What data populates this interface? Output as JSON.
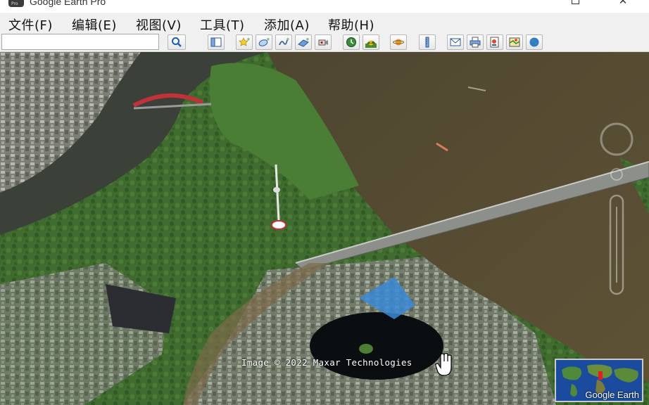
{
  "window": {
    "title": "Google Earth Pro",
    "app_icon_text": "Pro",
    "minimize_glyph": "—",
    "close_glyph": "✕"
  },
  "menu": {
    "items": [
      {
        "label": "文件(F)"
      },
      {
        "label": "编辑(E)"
      },
      {
        "label": "视图(V)"
      },
      {
        "label": "工具(T)"
      },
      {
        "label": "添加(A)"
      },
      {
        "label": "帮助(H)"
      }
    ]
  },
  "search": {
    "value": "",
    "placeholder": ""
  },
  "toolbar": {
    "icons": [
      "search-icon",
      "sidebar-toggle-icon",
      "placemark-icon",
      "polygon-icon",
      "path-icon",
      "image-overlay-icon",
      "record-tour-icon",
      "historical-imagery-icon",
      "sunlight-icon",
      "planets-icon",
      "ruler-icon",
      "email-icon",
      "print-icon",
      "save-image-icon",
      "view-in-maps-icon",
      "earth-icon"
    ]
  },
  "map": {
    "attribution": "Image © 2022 Maxar Technologies",
    "overview_label": "Google Earth",
    "colors": {
      "river": "#5a4e33",
      "river_dark": "#3a3f3a",
      "vegetation": "#3f6b2f",
      "city": "#8a8a82",
      "bridge_red": "#c0313a"
    }
  }
}
